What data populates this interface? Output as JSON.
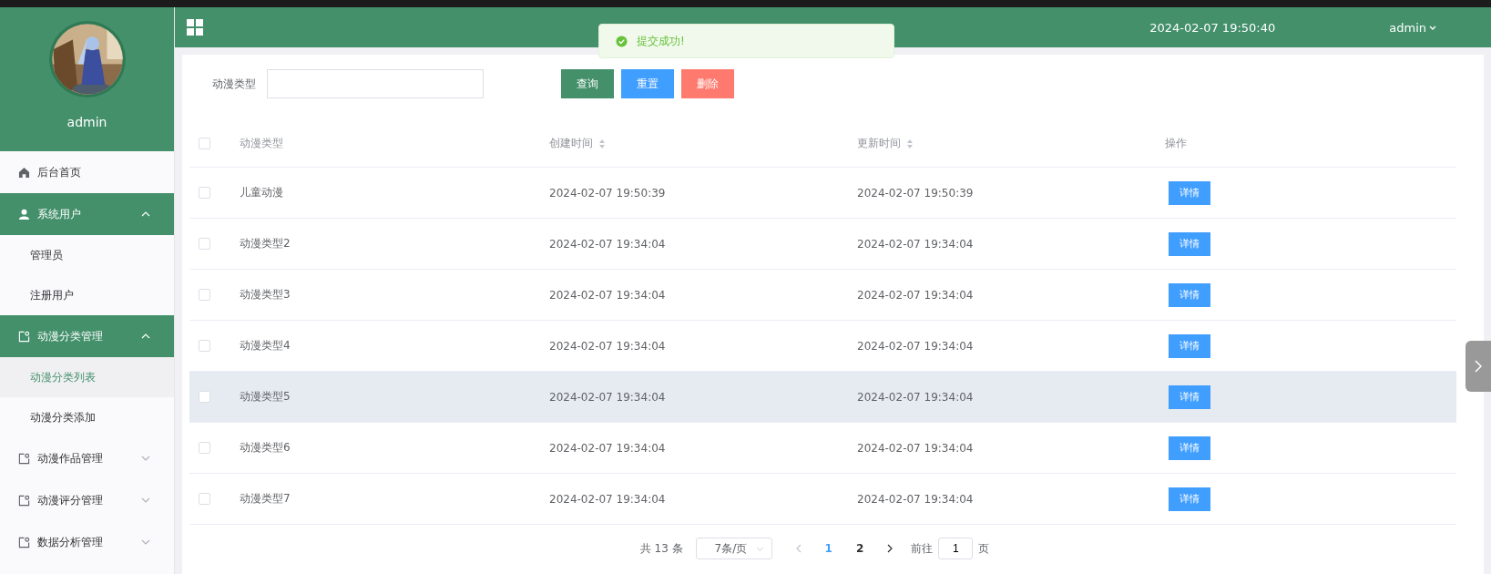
{
  "sidebar": {
    "user": "admin",
    "menu": [
      {
        "label": "后台首页",
        "kind": "link",
        "selected": false
      },
      {
        "label": "系统用户",
        "kind": "group",
        "expanded": true,
        "children": [
          {
            "label": "管理员",
            "selected": false
          },
          {
            "label": "注册用户",
            "selected": false
          }
        ]
      },
      {
        "label": "动漫分类管理",
        "kind": "group",
        "expanded": true,
        "children": [
          {
            "label": "动漫分类列表",
            "selected": true
          },
          {
            "label": "动漫分类添加",
            "selected": false
          }
        ]
      },
      {
        "label": "动漫作品管理",
        "kind": "group",
        "expanded": false
      },
      {
        "label": "动漫评分管理",
        "kind": "group",
        "expanded": false
      },
      {
        "label": "数据分析管理",
        "kind": "group",
        "expanded": false
      }
    ]
  },
  "header": {
    "datetime": "2024-02-07 19:50:40",
    "user": "admin"
  },
  "toast": {
    "message": "提交成功!"
  },
  "search": {
    "label": "动漫类型"
  },
  "buttons": [
    {
      "label": "查询",
      "kind": "primary"
    },
    {
      "label": "重置",
      "kind": "info"
    },
    {
      "label": "删除",
      "kind": "danger"
    }
  ],
  "table": {
    "columns": [
      {
        "label": "动漫类型",
        "sortable": false
      },
      {
        "label": "创建时间",
        "sortable": true
      },
      {
        "label": "更新时间",
        "sortable": true
      },
      {
        "label": "操作",
        "sortable": false
      }
    ],
    "header_checked": false,
    "rows": [
      {
        "type": "儿童动漫",
        "created": "2024-02-07 19:50:39",
        "updated": "2024-02-07 19:50:39",
        "action": "详情",
        "checked": false,
        "selected": false
      },
      {
        "type": "动漫类型2",
        "created": "2024-02-07 19:34:04",
        "updated": "2024-02-07 19:34:04",
        "action": "详情",
        "checked": false,
        "selected": false
      },
      {
        "type": "动漫类型3",
        "created": "2024-02-07 19:34:04",
        "updated": "2024-02-07 19:34:04",
        "action": "详情",
        "checked": false,
        "selected": false
      },
      {
        "type": "动漫类型4",
        "created": "2024-02-07 19:34:04",
        "updated": "2024-02-07 19:34:04",
        "action": "详情",
        "checked": false,
        "selected": false
      },
      {
        "type": "动漫类型5",
        "created": "2024-02-07 19:34:04",
        "updated": "2024-02-07 19:34:04",
        "action": "详情",
        "checked": false,
        "selected": true
      },
      {
        "type": "动漫类型6",
        "created": "2024-02-07 19:34:04",
        "updated": "2024-02-07 19:34:04",
        "action": "详情",
        "checked": false,
        "selected": false
      },
      {
        "type": "动漫类型7",
        "created": "2024-02-07 19:34:04",
        "updated": "2024-02-07 19:34:04",
        "action": "详情",
        "checked": false,
        "selected": false
      }
    ]
  },
  "pagination": {
    "total": "共 13 条",
    "page_size": "7条/页",
    "pages": [
      {
        "label": "1",
        "selected": true
      },
      {
        "label": "2",
        "selected": false
      }
    ],
    "goto_label": "前往",
    "goto_value": "1",
    "page_suffix": "页"
  }
}
